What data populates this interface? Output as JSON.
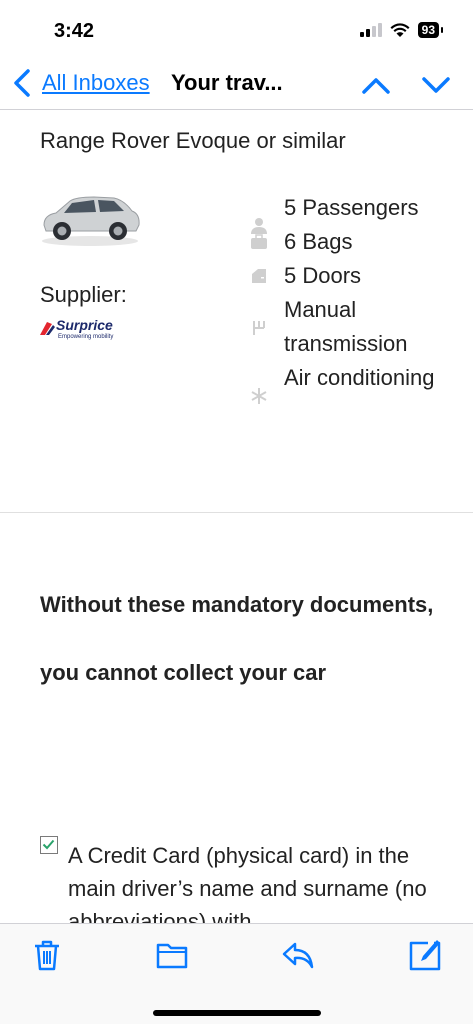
{
  "status_bar": {
    "time": "3:42",
    "battery": "93"
  },
  "nav": {
    "back_label": "All Inboxes",
    "title": "Your trav..."
  },
  "car": {
    "model": "Range Rover Evoque or similar",
    "supplier_label": "Supplier:"
  },
  "supplier_logo": {
    "name": "Surprice",
    "tagline": "Empowering mobility"
  },
  "features": [
    {
      "icon": "person-icon",
      "label": "5 Passengers"
    },
    {
      "icon": "bag-icon",
      "label": "6 Bags"
    },
    {
      "icon": "door-icon",
      "label": "5 Doors"
    },
    {
      "icon": "gear-shift-icon",
      "label": "Manual transmission"
    },
    {
      "icon": "snowflake-icon",
      "label": "Air conditioning"
    }
  ],
  "documents": {
    "heading": "Without these mandatory documents, you cannot collect your car",
    "items": [
      {
        "checked": true,
        "text": "A Credit Card (physical card) in the main driver’s name and surname (no abbreviations) with"
      }
    ]
  },
  "toolbar": {
    "trash": "trash-icon",
    "folder": "folder-icon",
    "reply": "reply-icon",
    "compose": "compose-icon"
  },
  "colors": {
    "accent": "#0a7aff",
    "logo": "#1d2a6b",
    "logo_red": "#e3262f",
    "check": "#2aa36b"
  }
}
